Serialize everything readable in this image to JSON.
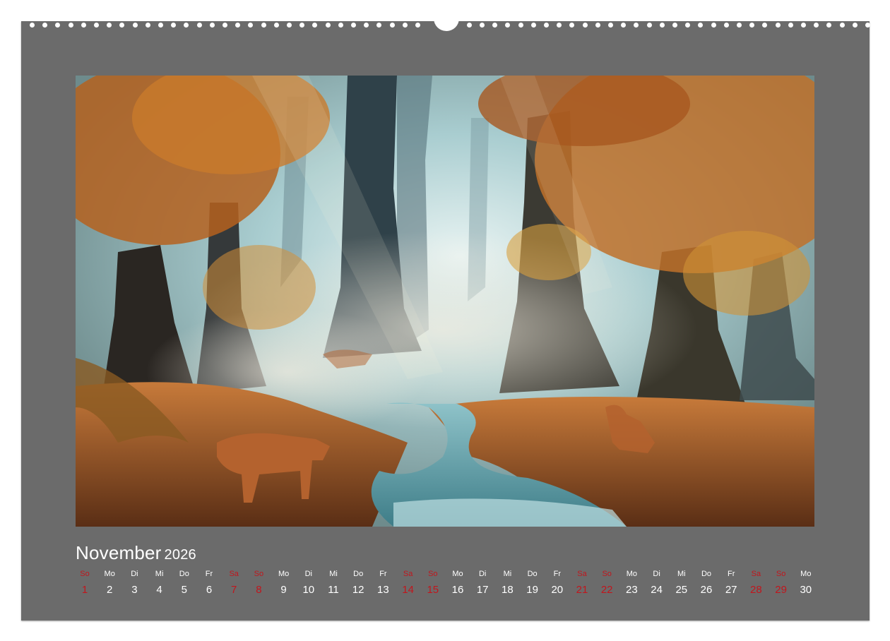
{
  "calendar": {
    "month": "November",
    "year": "2026",
    "days": [
      {
        "dow": "So",
        "num": "1",
        "weekend": true
      },
      {
        "dow": "Mo",
        "num": "2",
        "weekend": false
      },
      {
        "dow": "Di",
        "num": "3",
        "weekend": false
      },
      {
        "dow": "Mi",
        "num": "4",
        "weekend": false
      },
      {
        "dow": "Do",
        "num": "5",
        "weekend": false
      },
      {
        "dow": "Fr",
        "num": "6",
        "weekend": false
      },
      {
        "dow": "Sa",
        "num": "7",
        "weekend": true
      },
      {
        "dow": "So",
        "num": "8",
        "weekend": true
      },
      {
        "dow": "Mo",
        "num": "9",
        "weekend": false
      },
      {
        "dow": "Di",
        "num": "10",
        "weekend": false
      },
      {
        "dow": "Mi",
        "num": "11",
        "weekend": false
      },
      {
        "dow": "Do",
        "num": "12",
        "weekend": false
      },
      {
        "dow": "Fr",
        "num": "13",
        "weekend": false
      },
      {
        "dow": "Sa",
        "num": "14",
        "weekend": true
      },
      {
        "dow": "So",
        "num": "15",
        "weekend": true
      },
      {
        "dow": "Mo",
        "num": "16",
        "weekend": false
      },
      {
        "dow": "Di",
        "num": "17",
        "weekend": false
      },
      {
        "dow": "Mi",
        "num": "18",
        "weekend": false
      },
      {
        "dow": "Do",
        "num": "19",
        "weekend": false
      },
      {
        "dow": "Fr",
        "num": "20",
        "weekend": false
      },
      {
        "dow": "Sa",
        "num": "21",
        "weekend": true
      },
      {
        "dow": "So",
        "num": "22",
        "weekend": true
      },
      {
        "dow": "Mo",
        "num": "23",
        "weekend": false
      },
      {
        "dow": "Di",
        "num": "24",
        "weekend": false
      },
      {
        "dow": "Mi",
        "num": "25",
        "weekend": false
      },
      {
        "dow": "Do",
        "num": "26",
        "weekend": false
      },
      {
        "dow": "Fr",
        "num": "27",
        "weekend": false
      },
      {
        "dow": "Sa",
        "num": "28",
        "weekend": true
      },
      {
        "dow": "So",
        "num": "29",
        "weekend": true
      },
      {
        "dow": "Mo",
        "num": "30",
        "weekend": false
      }
    ]
  },
  "colors": {
    "page_background": "#6b6b6b",
    "weekend": "#c1161d",
    "weekday": "#ffffff"
  }
}
